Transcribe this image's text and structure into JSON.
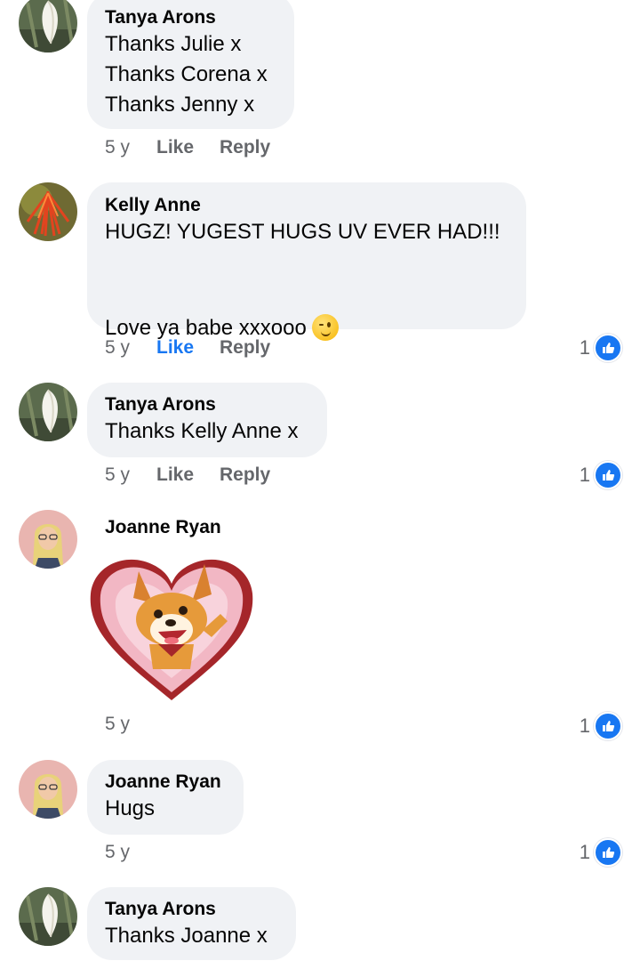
{
  "comments": [
    {
      "author": "Tanya Arons",
      "text": "Thanks Julie x\nThanks Corena x\nThanks Jenny x",
      "time": "5 y",
      "like": "Like",
      "reply": "Reply",
      "reactions": ""
    },
    {
      "author": "Kelly Anne",
      "text_line1": "HUGZ! YUGEST HUGS UV EVER HAD!!!",
      "text_line2": "Love ya babe xxxooo",
      "emoji": "winking-face-emoji",
      "time": "5 y",
      "like": "Like",
      "reply": "Reply",
      "reactions": "1"
    },
    {
      "author": "Tanya Arons",
      "text": "Thanks Kelly Anne x",
      "time": "5 y",
      "like": "Like",
      "reply": "Reply",
      "reactions": "1"
    },
    {
      "author": "Joanne Ryan",
      "sticker": "corgi-heart-sticker",
      "time": "5 y",
      "reactions": "1"
    },
    {
      "author": "Joanne Ryan",
      "text": "Hugs",
      "time": "5 y",
      "reactions": "1"
    },
    {
      "author": "Tanya Arons",
      "text": "Thanks Joanne x"
    }
  ],
  "colors": {
    "bubble": "#f0f2f5",
    "link_active": "#1877f2",
    "meta": "#65676b"
  },
  "icons": {
    "like_reaction": "thumbs-up-icon"
  }
}
